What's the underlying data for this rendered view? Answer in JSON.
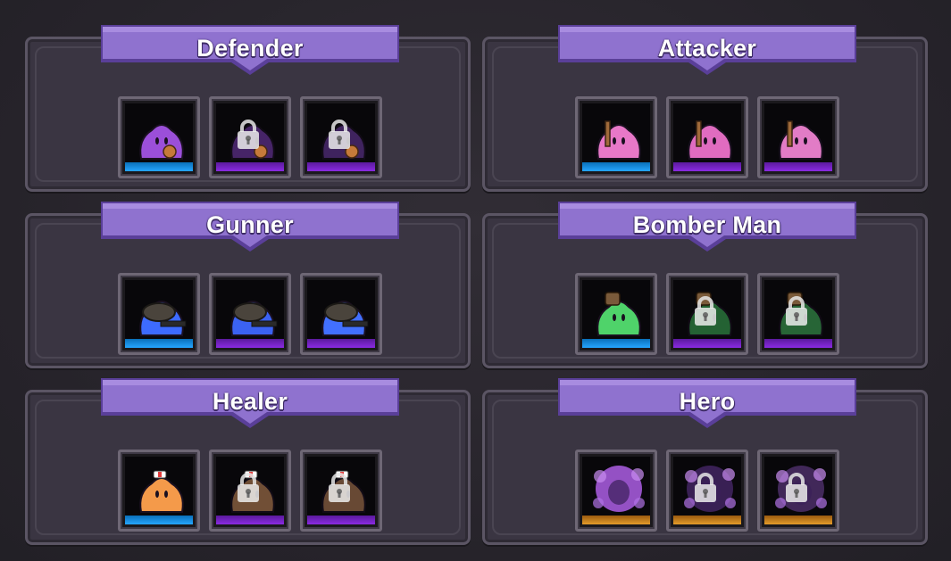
{
  "categories": [
    {
      "title": "Defender",
      "slots": [
        {
          "creature": "purple-slime-defender",
          "rarity": "blue",
          "locked": false
        },
        {
          "creature": "purple-slime-shield",
          "rarity": "purple",
          "locked": true
        },
        {
          "creature": "purple-slime-armored",
          "rarity": "purple",
          "locked": true
        }
      ]
    },
    {
      "title": "Attacker",
      "slots": [
        {
          "creature": "pink-slime-club",
          "rarity": "blue",
          "locked": false
        },
        {
          "creature": "pink-slime-knight",
          "rarity": "purple",
          "locked": false
        },
        {
          "creature": "pink-slime-axe",
          "rarity": "purple",
          "locked": false
        }
      ]
    },
    {
      "title": "Gunner",
      "slots": [
        {
          "creature": "blue-slime-helmet-gun",
          "rarity": "blue",
          "locked": false
        },
        {
          "creature": "blue-slime-goggles-rifle",
          "rarity": "purple",
          "locked": false
        },
        {
          "creature": "blue-slime-sniper",
          "rarity": "purple",
          "locked": false
        }
      ]
    },
    {
      "title": "Bomber Man",
      "slots": [
        {
          "creature": "green-slime-bomb",
          "rarity": "blue",
          "locked": false
        },
        {
          "creature": "green-slime-grenade",
          "rarity": "purple",
          "locked": true
        },
        {
          "creature": "green-slime-hat",
          "rarity": "purple",
          "locked": true
        }
      ]
    },
    {
      "title": "Healer",
      "slots": [
        {
          "creature": "orange-slime-nurse",
          "rarity": "blue",
          "locked": false
        },
        {
          "creature": "orange-slime-medkit",
          "rarity": "purple",
          "locked": true
        },
        {
          "creature": "orange-slime-syringe",
          "rarity": "purple",
          "locked": true
        }
      ]
    },
    {
      "title": "Hero",
      "slots": [
        {
          "creature": "hero-purple-mage",
          "rarity": "gold",
          "locked": false
        },
        {
          "creature": "hero-purple-warrior",
          "rarity": "gold",
          "locked": true
        },
        {
          "creature": "hero-purple-scholar",
          "rarity": "gold",
          "locked": true
        }
      ]
    }
  ],
  "colors": {
    "banner_fill": "#8f72cf",
    "banner_dark": "#6b4fb0",
    "rarity_blue": "#26a6ff",
    "rarity_purple": "#8a2be2",
    "rarity_gold": "#e49c2a",
    "background": "#2a272d"
  },
  "icons": {
    "lock": "lock-icon",
    "creatures": [
      "slime-icon"
    ]
  }
}
